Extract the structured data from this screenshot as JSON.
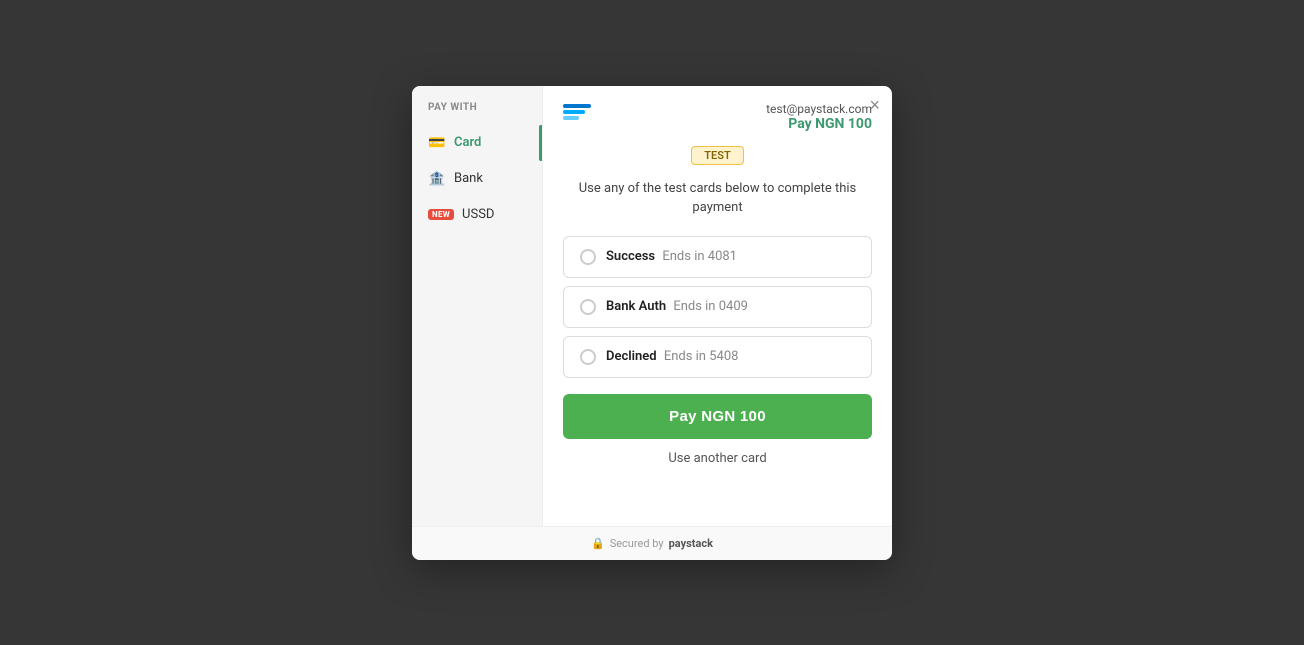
{
  "page": {
    "background_color": "#4a4a4a"
  },
  "modal": {
    "close_button_label": "×",
    "header": {
      "email": "test@paystack.com",
      "pay_label": "Pay",
      "currency": "NGN",
      "amount": "100",
      "pay_amount_text": "Pay NGN 100"
    },
    "test_badge": "TEST",
    "instruction": "Use any of the test cards below to complete this payment",
    "sidebar": {
      "title": "PAY WITH",
      "items": [
        {
          "id": "card",
          "label": "Card",
          "icon": "💳",
          "active": true,
          "new": false
        },
        {
          "id": "bank",
          "label": "Bank",
          "icon": "🏦",
          "active": false,
          "new": false
        },
        {
          "id": "ussd",
          "label": "USSD",
          "icon": "",
          "active": false,
          "new": true
        }
      ]
    },
    "card_options": [
      {
        "id": "success",
        "name": "Success",
        "ends_label": "Ends in 4081"
      },
      {
        "id": "bank-auth",
        "name": "Bank Auth",
        "ends_label": "Ends in 0409"
      },
      {
        "id": "declined",
        "name": "Declined",
        "ends_label": "Ends in 5408"
      }
    ],
    "pay_button_label": "Pay NGN 100",
    "use_another_card_label": "Use another card",
    "footer": {
      "secured_by": "Secured by",
      "brand": "paystack"
    }
  }
}
